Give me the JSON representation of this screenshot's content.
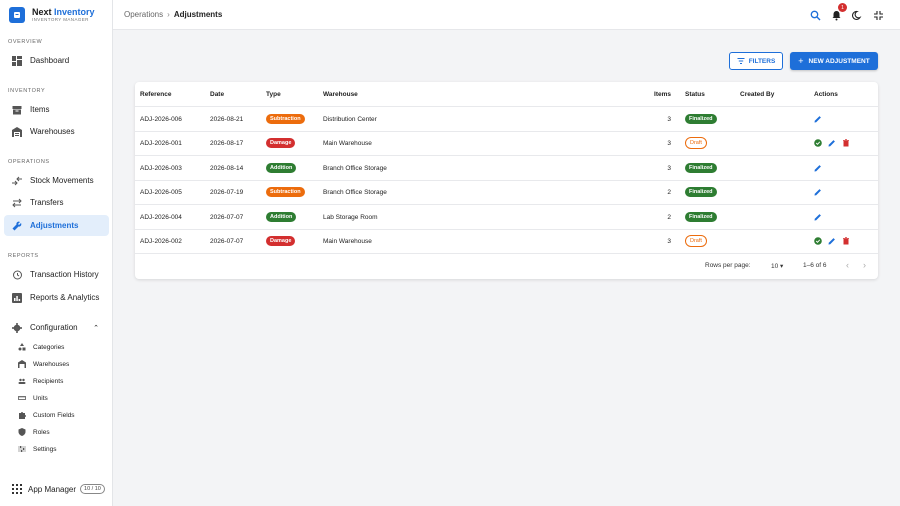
{
  "brand": {
    "name_part1": "Next",
    "name_part2": "Inventory",
    "subtitle": "INVENTORY MANAGER"
  },
  "sidebar": {
    "sections": {
      "overview": "OVERVIEW",
      "inventory": "INVENTORY",
      "operations": "OPERATIONS",
      "reports": "REPORTS"
    },
    "items": {
      "dashboard": "Dashboard",
      "items": "Items",
      "warehouses": "Warehouses",
      "stock_movements": "Stock Movements",
      "transfers": "Transfers",
      "adjustments": "Adjustments",
      "transaction_history": "Transaction History",
      "reports_analytics": "Reports & Analytics",
      "configuration": "Configuration"
    },
    "config_items": [
      "Categories",
      "Warehouses",
      "Recipients",
      "Units",
      "Custom Fields",
      "Roles",
      "Settings"
    ],
    "app_manager": {
      "label": "App Manager",
      "badge": "10 / 10"
    }
  },
  "header": {
    "breadcrumb_parent": "Operations",
    "breadcrumb_sep": "›",
    "breadcrumb_current": "Adjustments",
    "notification_count": "1"
  },
  "toolbar": {
    "filters_label": "FILTERS",
    "new_label": "NEW ADJUSTMENT"
  },
  "table": {
    "columns": {
      "reference": "Reference",
      "date": "Date",
      "type": "Type",
      "warehouse": "Warehouse",
      "items": "Items",
      "status": "Status",
      "created_by": "Created By",
      "actions": "Actions"
    },
    "rows": [
      {
        "reference": "ADJ-2026-006",
        "date": "2026-08-21",
        "type": "Subtraction",
        "warehouse": "Distribution Center",
        "items": "3",
        "status": "Finalized",
        "created_by": ""
      },
      {
        "reference": "ADJ-2026-001",
        "date": "2026-08-17",
        "type": "Damage",
        "warehouse": "Main Warehouse",
        "items": "3",
        "status": "Draft",
        "created_by": ""
      },
      {
        "reference": "ADJ-2026-003",
        "date": "2026-08-14",
        "type": "Addition",
        "warehouse": "Branch Office Storage",
        "items": "3",
        "status": "Finalized",
        "created_by": ""
      },
      {
        "reference": "ADJ-2026-005",
        "date": "2026-07-19",
        "type": "Subtraction",
        "warehouse": "Branch Office Storage",
        "items": "2",
        "status": "Finalized",
        "created_by": ""
      },
      {
        "reference": "ADJ-2026-004",
        "date": "2026-07-07",
        "type": "Addition",
        "warehouse": "Lab Storage Room",
        "items": "2",
        "status": "Finalized",
        "created_by": ""
      },
      {
        "reference": "ADJ-2026-002",
        "date": "2026-07-07",
        "type": "Damage",
        "warehouse": "Main Warehouse",
        "items": "3",
        "status": "Draft",
        "created_by": ""
      }
    ],
    "footer": {
      "rows_per_page_label": "Rows per page:",
      "rows_per_page_value": "10",
      "range": "1–6 of 6"
    }
  },
  "colors": {
    "primary": "#1e6fd9",
    "subtraction": "#ec6c0d",
    "damage": "#d32f2f",
    "addition": "#2e7d32",
    "finalized": "#2e7d32"
  }
}
